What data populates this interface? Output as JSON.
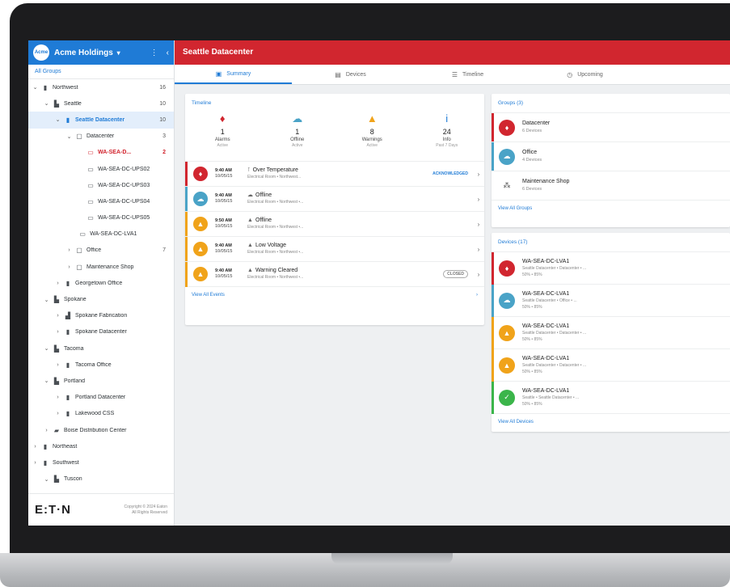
{
  "sidebar": {
    "org_name": "Acme Holdings",
    "logo_text": "Acme",
    "all_groups": "All Groups",
    "tree": [
      {
        "label": "Northwest",
        "count": "16",
        "depth": 0,
        "chev": "v",
        "icon": "building-icon"
      },
      {
        "label": "Seattle",
        "count": "10",
        "depth": 1,
        "chev": "v",
        "icon": "city-icon"
      },
      {
        "label": "Seattle Datacenter",
        "count": "10",
        "depth": 2,
        "chev": "v",
        "icon": "building-icon",
        "state": "sel"
      },
      {
        "label": "Datacenter",
        "count": "3",
        "depth": 3,
        "chev": "v",
        "icon": "room-icon"
      },
      {
        "label": "WA-SEA-D...",
        "count": "2",
        "depth": 4,
        "chev": "",
        "icon": "device-icon",
        "state": "alarm"
      },
      {
        "label": "WA-SEA-DC-UPS02",
        "count": "",
        "depth": 4,
        "chev": "",
        "icon": "device-icon"
      },
      {
        "label": "WA-SEA-DC-UPS03",
        "count": "",
        "depth": 4,
        "chev": "",
        "icon": "device-icon"
      },
      {
        "label": "WA-SEA-DC-UPS04",
        "count": "",
        "depth": 4,
        "chev": "",
        "icon": "device-icon"
      },
      {
        "label": "WA-SEA-DC-UPS05",
        "count": "",
        "depth": 4,
        "chev": "",
        "icon": "device-icon"
      },
      {
        "label": "WA-SEA-DC-LVA1",
        "count": "",
        "depth": 3.3,
        "chev": "",
        "icon": "device-icon"
      },
      {
        "label": "Office",
        "count": "7",
        "depth": 3,
        "chev": ">",
        "icon": "room-icon"
      },
      {
        "label": "Maintenance Shop",
        "count": "",
        "depth": 3,
        "chev": ">",
        "icon": "room-icon"
      },
      {
        "label": "Georgetown Office",
        "count": "",
        "depth": 2,
        "chev": ">",
        "icon": "building-icon"
      },
      {
        "label": "Spokane",
        "count": "",
        "depth": 1,
        "chev": "v",
        "icon": "city-icon"
      },
      {
        "label": "Spokane Fabrication",
        "count": "",
        "depth": 2,
        "chev": ">",
        "icon": "factory-icon"
      },
      {
        "label": "Spokane Datacenter",
        "count": "",
        "depth": 2,
        "chev": ">",
        "icon": "building-icon"
      },
      {
        "label": "Tacoma",
        "count": "",
        "depth": 1,
        "chev": "v",
        "icon": "city-icon"
      },
      {
        "label": "Tacoma Office",
        "count": "",
        "depth": 2,
        "chev": ">",
        "icon": "building-icon"
      },
      {
        "label": "Portland",
        "count": "",
        "depth": 1,
        "chev": "v",
        "icon": "city-icon"
      },
      {
        "label": "Portland Datacenter",
        "count": "",
        "depth": 2,
        "chev": ">",
        "icon": "building-icon"
      },
      {
        "label": "Lakewood CSS",
        "count": "",
        "depth": 2,
        "chev": ">",
        "icon": "building-icon"
      },
      {
        "label": "Boise Distribution Center",
        "count": "",
        "depth": 1,
        "chev": ">",
        "icon": "truck-icon"
      },
      {
        "label": "Northeast",
        "count": "",
        "depth": 0,
        "chev": ">",
        "icon": "building-icon"
      },
      {
        "label": "Southwest",
        "count": "",
        "depth": 0,
        "chev": ">",
        "icon": "building-icon"
      },
      {
        "label": "Tuscon",
        "count": "",
        "depth": 1,
        "chev": "v",
        "icon": "city-icon"
      }
    ],
    "brand": "E:T·N",
    "copyright_line1": "Copyright © 2024 Eaton",
    "copyright_line2": "All Rights Reserved"
  },
  "header": {
    "title": "Seattle Datacenter"
  },
  "tabs": [
    {
      "label": "Summary",
      "icon": "summary-icon",
      "active": true
    },
    {
      "label": "Devices",
      "icon": "devices-icon",
      "active": false
    },
    {
      "label": "Timeline",
      "icon": "list-icon",
      "active": false
    },
    {
      "label": "Upcoming",
      "icon": "clock-icon",
      "active": false
    }
  ],
  "timeline": {
    "title": "Timeline",
    "stats": [
      {
        "value": "1",
        "label": "Alarms",
        "sub": "Active",
        "icon": "bell-icon",
        "color": "#d1262f"
      },
      {
        "value": "1",
        "label": "Offline",
        "sub": "Active",
        "icon": "cloud-offline-icon",
        "color": "#4aa3c7"
      },
      {
        "value": "8",
        "label": "Warnings",
        "sub": "Active",
        "icon": "warning-icon",
        "color": "#f0a31a"
      },
      {
        "value": "24",
        "label": "Info",
        "sub": "Past 7 Days",
        "icon": "info-icon",
        "color": "#1f7bd6"
      }
    ],
    "events": [
      {
        "time": "9:40 AM",
        "date": "10/05/15",
        "title": "Over Temperature",
        "sub": "Electrical Room • Northwest...",
        "tag": "ACKNOWLEDGED",
        "color": "#d1262f",
        "icon": "bell-icon",
        "ticon": "thermometer-icon"
      },
      {
        "time": "9:40 AM",
        "date": "10/05/15",
        "title": "Offline",
        "sub": "Electrical Room • Northwest •...",
        "tag": "",
        "color": "#4aa3c7",
        "icon": "cloud-offline-icon",
        "ticon": "cloud-offline-icon"
      },
      {
        "time": "9:50 AM",
        "date": "10/05/15",
        "title": "Offline",
        "sub": "Electrical Room • Northwest •...",
        "tag": "",
        "color": "#f0a31a",
        "icon": "warning-icon",
        "ticon": "warning-icon"
      },
      {
        "time": "9:40 AM",
        "date": "10/05/15",
        "title": "Low Voltage",
        "sub": "Electrical Room • Northwest •...",
        "tag": "",
        "color": "#f0a31a",
        "icon": "warning-icon",
        "ticon": "warning-icon"
      },
      {
        "time": "9:40 AM",
        "date": "10/05/15",
        "title": "Warning Cleared",
        "sub": "Electrical Room • Northwest •...",
        "tag": "CLOSED",
        "color": "#f0a31a",
        "icon": "warning-icon",
        "ticon": "warning-icon"
      }
    ],
    "view_all": "View All Events"
  },
  "groups": {
    "title": "Groups (3)",
    "items": [
      {
        "name": "Datacenter",
        "sub": "6 Devices",
        "color": "#d1262f",
        "icon": "bell-icon"
      },
      {
        "name": "Office",
        "sub": "4 Devices",
        "color": "#4aa3c7",
        "icon": "cloud-offline-icon"
      },
      {
        "name": "Maintenance Shop",
        "sub": "6 Devices",
        "color": "",
        "icon": "group-icon"
      }
    ],
    "view_all": "View All Groups"
  },
  "devices": {
    "title": "Devices (17)",
    "items": [
      {
        "name": "WA-SEA-DC-LVA1",
        "sub": "Seattle Datacenter • Datacenter • ...",
        "meta": "50% • 85%",
        "color": "#d1262f",
        "icon": "bell-icon"
      },
      {
        "name": "WA-SEA-DC-LVA1",
        "sub": "Seattle Datacenter • Office • ...",
        "meta": "50% • 85%",
        "color": "#4aa3c7",
        "icon": "cloud-offline-icon"
      },
      {
        "name": "WA-SEA-DC-LVA1",
        "sub": "Seattle Datacenter • Datacenter • ...",
        "meta": "50% • 85%",
        "color": "#f0a31a",
        "icon": "warning-icon"
      },
      {
        "name": "WA-SEA-DC-LVA1",
        "sub": "Seattle Datacenter • Datacenter • ...",
        "meta": "50% • 85%",
        "color": "#f0a31a",
        "icon": "warning-icon"
      },
      {
        "name": "WA-SEA-DC-LVA1",
        "sub": "Seattle • Seattle Datacenter • ...",
        "meta": "50% • 85%",
        "color": "#3bb54a",
        "icon": "check-icon"
      }
    ],
    "view_all": "View All Devices"
  }
}
